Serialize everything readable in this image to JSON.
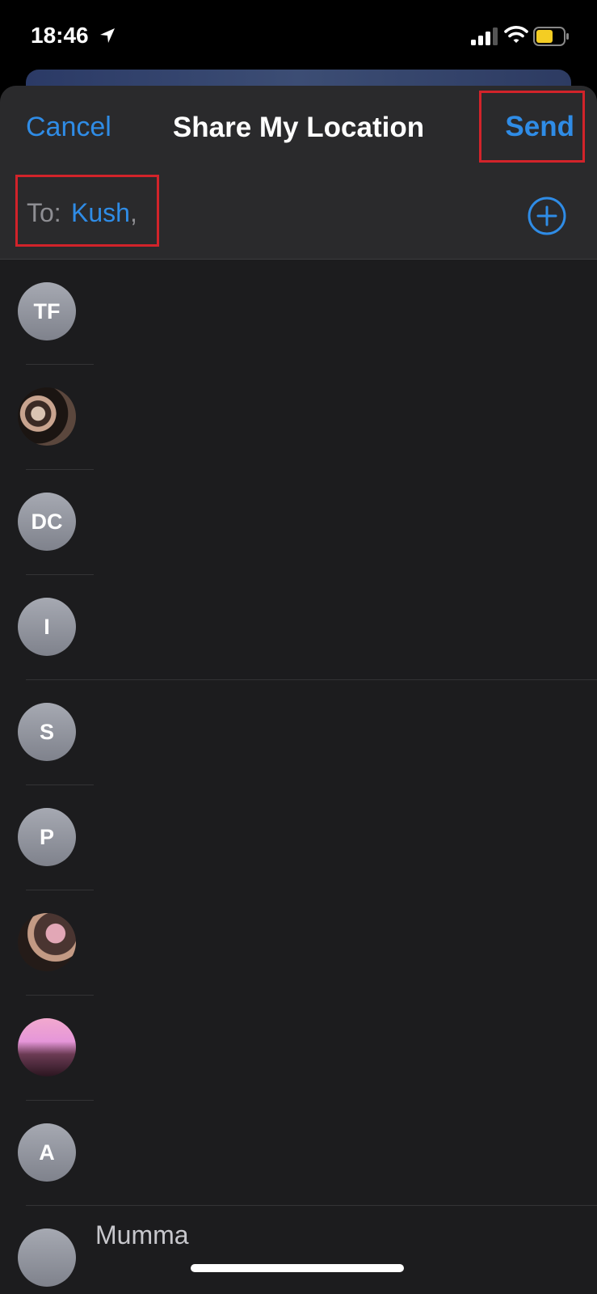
{
  "status": {
    "time": "18:46"
  },
  "nav": {
    "cancel_label": "Cancel",
    "title": "Share My Location",
    "send_label": "Send"
  },
  "recipients": {
    "to_label": "To:",
    "name": "Kush",
    "separator": ","
  },
  "contacts": [
    {
      "initials": "TF"
    },
    {
      "initials": ""
    },
    {
      "initials": "DC"
    },
    {
      "initials": "I"
    },
    {
      "initials": "S"
    },
    {
      "initials": "P"
    },
    {
      "initials": ""
    },
    {
      "initials": ""
    },
    {
      "initials": "A"
    },
    {
      "initials": "",
      "name": "Mumma"
    }
  ],
  "colors": {
    "accent": "#2f8ce6",
    "highlight": "#d2232a",
    "sheet": "#1c1c1e"
  }
}
